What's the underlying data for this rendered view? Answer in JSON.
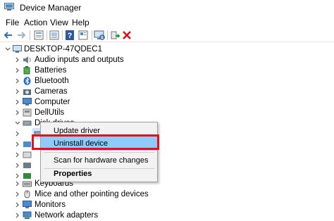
{
  "window": {
    "title": "Device Manager"
  },
  "menu": [
    "File",
    "Action",
    "View",
    "Help"
  ],
  "toolbar": {
    "buttons": [
      "back-icon",
      "forward-icon",
      "properties-icon",
      "update-icon",
      "help-icon",
      "view-icon",
      "scan-icon",
      "enable-icon",
      "uninstall-icon"
    ]
  },
  "tree": {
    "root": "DESKTOP-47QDEC1",
    "categories": [
      "Audio inputs and outputs",
      "Batteries",
      "Bluetooth",
      "Cameras",
      "Computer",
      "DellUtils",
      "Disk drives",
      "Keyboards",
      "Mice and other pointing devices",
      "Monitors",
      "Network adapters"
    ]
  },
  "context_menu": {
    "items": [
      {
        "label": "Update driver"
      },
      {
        "label": "Uninstall device"
      },
      {
        "label": "Scan for hardware changes"
      },
      {
        "label": "Properties"
      }
    ]
  },
  "colors": {
    "highlight_box": "#e3101f",
    "menu_hover": "#91c9f7",
    "selection": "#cce8ff"
  }
}
